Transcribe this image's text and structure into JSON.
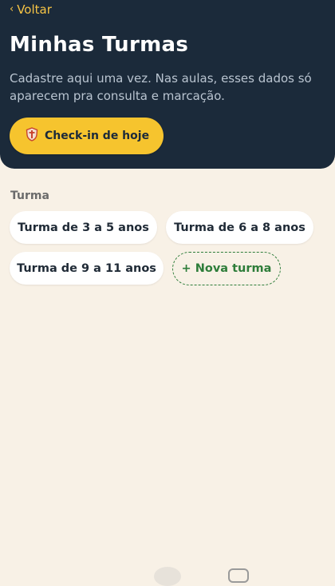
{
  "header": {
    "back_label": "Voltar",
    "back_icon": "chevron-left-icon",
    "title": "Minhas Turmas",
    "subtitle": "Cadastre aqui uma vez. Nas aulas, esses dados só aparecem pra consulta e marcação.",
    "checkin_label": "Check-in de hoje",
    "checkin_icon": "shield-icon"
  },
  "section": {
    "label": "Turma",
    "classes": [
      {
        "label": "Turma de 3 a 5 anos"
      },
      {
        "label": "Turma de 6 a 8 anos"
      },
      {
        "label": "Turma de 9 a 11 anos"
      }
    ],
    "new_class_label": "+ Nova turma"
  },
  "colors": {
    "header_bg": "#1b2a3a",
    "page_bg": "#f8f1e6",
    "accent": "#f6c42e",
    "new_class": "#2e7d3a"
  }
}
